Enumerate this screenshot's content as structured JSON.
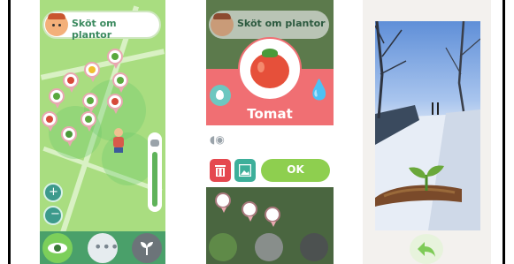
{
  "screen1": {
    "title": "Sköt om plantor",
    "icons": [
      "gardener-avatar-icon",
      "zoom-in-icon",
      "zoom-out-icon",
      "eye-icon",
      "more-icon",
      "sprout-icon",
      "watering-can-icon"
    ],
    "colors": {
      "map": "#a9dd80",
      "accent": "#e8a8b0",
      "bar": "#4aa06a"
    }
  },
  "screen2": {
    "title": "Sköt om plantor",
    "plant_name": "Tomat",
    "ok_label": "OK",
    "icons": [
      "tomato-icon",
      "water-drop-icon",
      "trash-icon",
      "image-icon",
      "watering-can-icon"
    ],
    "colors": {
      "header": "#f06f73",
      "ok": "#8ecf4f"
    }
  },
  "screen3": {
    "icons": [
      "sprout-icon",
      "back-arrow-icon"
    ],
    "colors": {
      "snow": "#e9eff8",
      "back": "#7ecb57"
    }
  }
}
